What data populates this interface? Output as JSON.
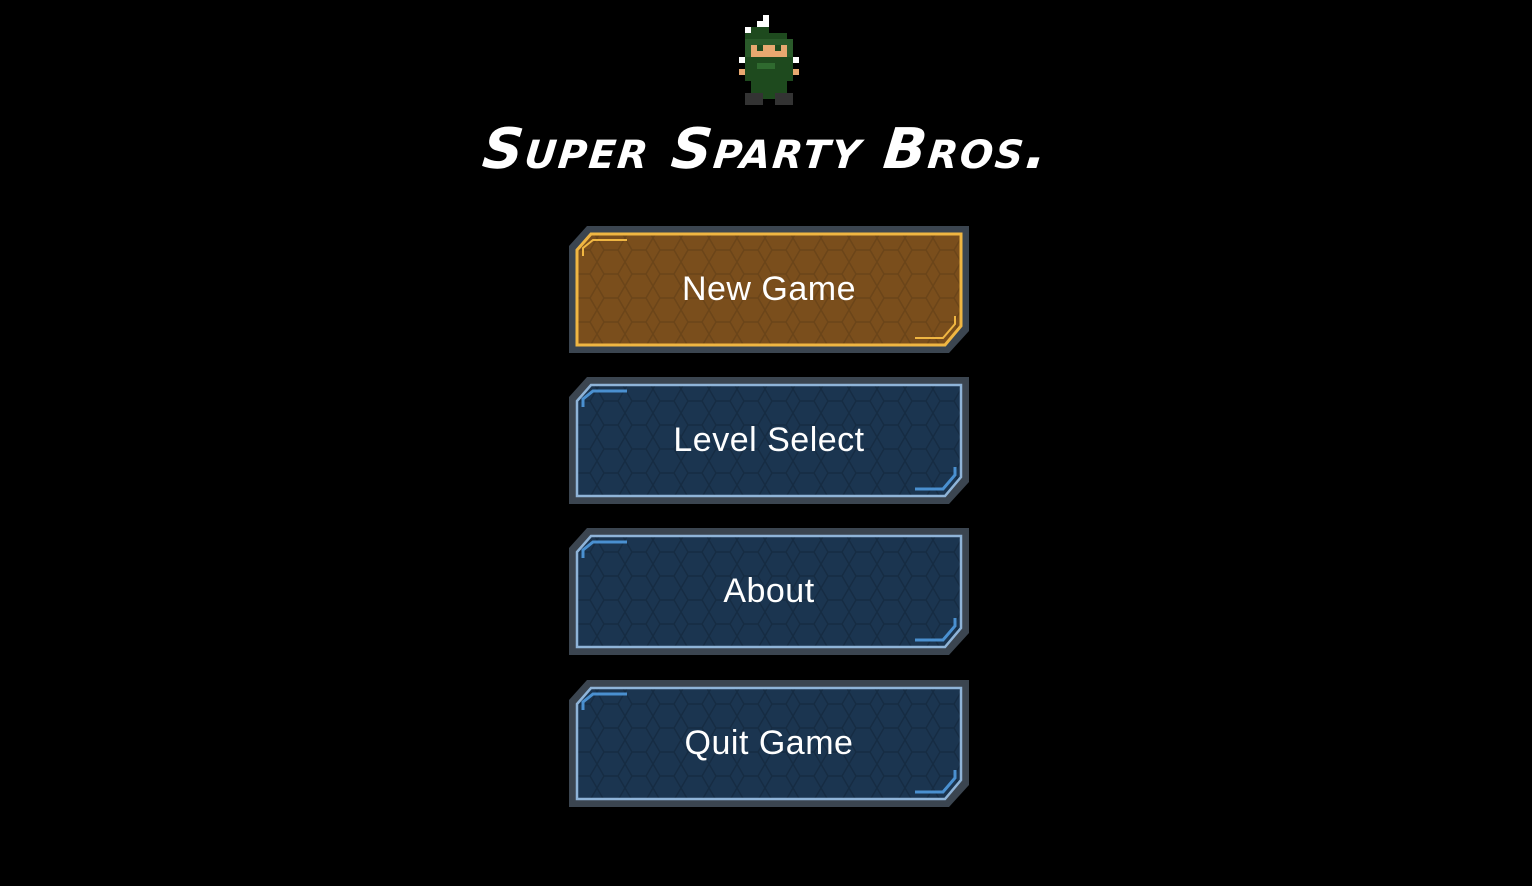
{
  "game": {
    "title": "Super Sparty Bros."
  },
  "menu": {
    "items": [
      {
        "label": "New Game",
        "selected": true
      },
      {
        "label": "Level Select",
        "selected": false
      },
      {
        "label": "About",
        "selected": false
      },
      {
        "label": "Quit Game",
        "selected": false
      }
    ]
  },
  "colors": {
    "background": "#000000",
    "selected_fill": "#7a4e1c",
    "selected_border": "#f0b642",
    "default_fill": "#1b3550",
    "default_border": "#4a90d0",
    "frame": "#3b4550",
    "sprite_green": "#1e4a1e",
    "sprite_skin": "#e8a870"
  },
  "icons": {
    "character": "green-hooded-pixel-character-icon"
  }
}
